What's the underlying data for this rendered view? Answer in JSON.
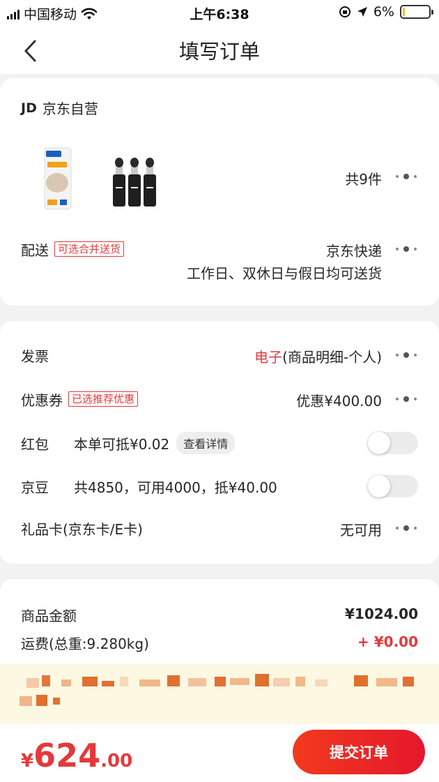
{
  "status_bar": {
    "carrier": "中国移动",
    "time": "上午6:38",
    "battery_percent": "6%",
    "battery_level": 0.06
  },
  "navbar": {
    "title": "填写订单"
  },
  "shop": {
    "name": "京东自营",
    "logo_text": "JD",
    "item_count": "共9件"
  },
  "delivery": {
    "label": "配送",
    "tag": "可选合并送货",
    "method": "京东快递",
    "schedule": "工作日、双休日与假日均可送货"
  },
  "invoice": {
    "label": "发票",
    "type": "电子",
    "detail": "(商品明细-个人)"
  },
  "coupon": {
    "label": "优惠券",
    "tag": "已选推荐优惠",
    "value": "优惠¥400.00"
  },
  "red_packet": {
    "label": "红包",
    "desc": "本单可抵¥0.02",
    "detail_link": "查看详情",
    "enabled": false
  },
  "jingdou": {
    "label": "京豆",
    "desc": "共4850，可用4000，抵¥40.00",
    "enabled": false
  },
  "gift_card": {
    "label": "礼品卡(京东卡/E卡)",
    "value": "无可用"
  },
  "summary": {
    "goods_label": "商品金额",
    "goods_amount": "¥1024.00",
    "shipping_label": "运费(总重:9.280kg)",
    "shipping_amount": "+ ¥0.00"
  },
  "bottom": {
    "currency": "¥",
    "total_int": "624",
    "total_dec": ".00",
    "submit_label": "提交订单"
  },
  "colors": {
    "accent_red": "#e4393c",
    "banner_bg": "#fdf8e2"
  }
}
